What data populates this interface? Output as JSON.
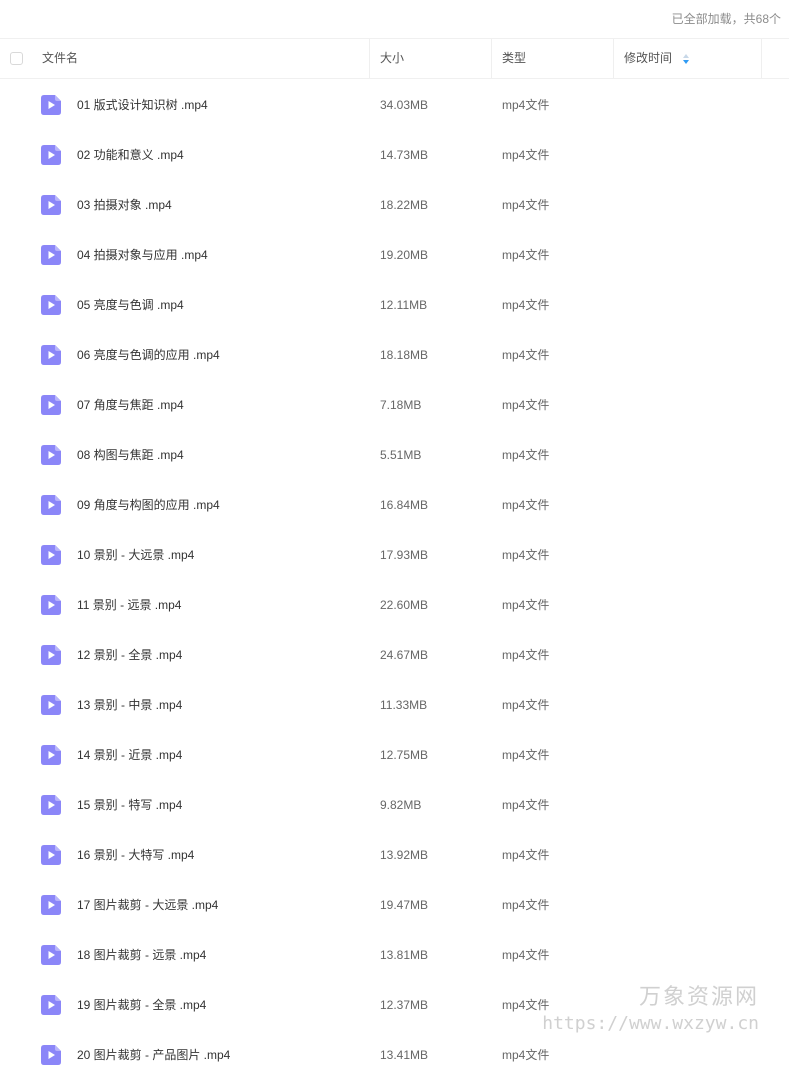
{
  "status": "已全部加载，共68个",
  "columns": {
    "name": "文件名",
    "size": "大小",
    "type": "类型",
    "modified": "修改时间"
  },
  "icons": {
    "file": "video-file-icon",
    "sort": "sort-icon",
    "accent_color": "#8b86f8",
    "sort_color": "#2f9bf4"
  },
  "files": [
    {
      "name": "01 版式设计知识树 .mp4",
      "size": "34.03MB",
      "type": "mp4文件"
    },
    {
      "name": "02 功能和意义 .mp4",
      "size": "14.73MB",
      "type": "mp4文件"
    },
    {
      "name": "03 拍摄对象 .mp4",
      "size": "18.22MB",
      "type": "mp4文件"
    },
    {
      "name": "04 拍摄对象与应用 .mp4",
      "size": "19.20MB",
      "type": "mp4文件"
    },
    {
      "name": "05 亮度与色调 .mp4",
      "size": "12.11MB",
      "type": "mp4文件"
    },
    {
      "name": "06 亮度与色调的应用 .mp4",
      "size": "18.18MB",
      "type": "mp4文件"
    },
    {
      "name": "07 角度与焦距 .mp4",
      "size": "7.18MB",
      "type": "mp4文件"
    },
    {
      "name": "08 构图与焦距 .mp4",
      "size": "5.51MB",
      "type": "mp4文件"
    },
    {
      "name": "09 角度与构图的应用 .mp4",
      "size": "16.84MB",
      "type": "mp4文件"
    },
    {
      "name": "10 景别 - 大远景 .mp4",
      "size": "17.93MB",
      "type": "mp4文件"
    },
    {
      "name": "11 景别 - 远景 .mp4",
      "size": "22.60MB",
      "type": "mp4文件"
    },
    {
      "name": "12 景别 - 全景 .mp4",
      "size": "24.67MB",
      "type": "mp4文件"
    },
    {
      "name": "13 景别 - 中景 .mp4",
      "size": "11.33MB",
      "type": "mp4文件"
    },
    {
      "name": "14 景别 - 近景 .mp4",
      "size": "12.75MB",
      "type": "mp4文件"
    },
    {
      "name": "15 景别 - 特写 .mp4",
      "size": "9.82MB",
      "type": "mp4文件"
    },
    {
      "name": "16 景别 - 大特写 .mp4",
      "size": "13.92MB",
      "type": "mp4文件"
    },
    {
      "name": "17 图片裁剪 - 大远景 .mp4",
      "size": "19.47MB",
      "type": "mp4文件"
    },
    {
      "name": "18 图片裁剪 - 远景 .mp4",
      "size": "13.81MB",
      "type": "mp4文件"
    },
    {
      "name": "19 图片裁剪 - 全景 .mp4",
      "size": "12.37MB",
      "type": "mp4文件"
    },
    {
      "name": "20 图片裁剪 - 产品图片 .mp4",
      "size": "13.41MB",
      "type": "mp4文件"
    }
  ],
  "watermark": {
    "brand": "万象资源网",
    "url": "https://www.wxzyw.cn"
  }
}
